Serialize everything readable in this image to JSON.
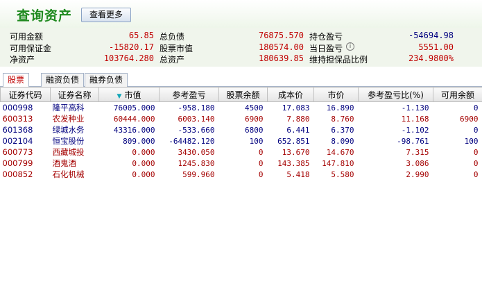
{
  "header": {
    "title": "查询资产",
    "more_button": "查看更多"
  },
  "summary": {
    "available_funds_label": "可用金额",
    "available_funds": "65.85",
    "available_margin_label": "可用保证金",
    "available_margin": "-15820.17",
    "net_assets_label": "净资产",
    "net_assets": "103764.280",
    "total_liabilities_label": "总负债",
    "total_liabilities": "76875.570",
    "stock_value_label": "股票市值",
    "stock_value": "180574.00",
    "total_assets_label": "总资产",
    "total_assets": "180639.85",
    "position_pnl_label": "持仓盈亏",
    "position_pnl": "-54694.98",
    "daily_pnl_label": "当日盈亏",
    "daily_pnl": "5551.00",
    "collateral_ratio_label": "维持担保品比例",
    "collateral_ratio": "234.9800%",
    "info_icon": "i"
  },
  "tabs": [
    "股票",
    "融资负债",
    "融券负债"
  ],
  "table": {
    "columns": [
      "证券代码",
      "证券名称",
      "市值",
      "参考盈亏",
      "股票余额",
      "成本价",
      "市价",
      "参考盈亏比(%)",
      "可用余额"
    ],
    "rows": [
      [
        "000998",
        "隆平高科",
        "76005.000",
        "-958.180",
        "4500",
        "17.083",
        "16.890",
        "-1.130",
        "0"
      ],
      [
        "600313",
        "农发种业",
        "60444.000",
        "6003.140",
        "6900",
        "7.880",
        "8.760",
        "11.168",
        "6900"
      ],
      [
        "601368",
        "绿城水务",
        "43316.000",
        "-533.660",
        "6800",
        "6.441",
        "6.370",
        "-1.102",
        "0"
      ],
      [
        "002104",
        "恒宝股份",
        "809.000",
        "-64482.120",
        "100",
        "652.851",
        "8.090",
        "-98.761",
        "100"
      ],
      [
        "600773",
        "西藏城投",
        "0.000",
        "3430.050",
        "0",
        "13.670",
        "14.670",
        "7.315",
        "0"
      ],
      [
        "000799",
        "酒鬼酒",
        "0.000",
        "1245.830",
        "0",
        "143.385",
        "147.810",
        "3.086",
        "0"
      ],
      [
        "000852",
        "石化机械",
        "0.000",
        "599.960",
        "0",
        "5.418",
        "5.580",
        "2.990",
        "0"
      ]
    ]
  }
}
